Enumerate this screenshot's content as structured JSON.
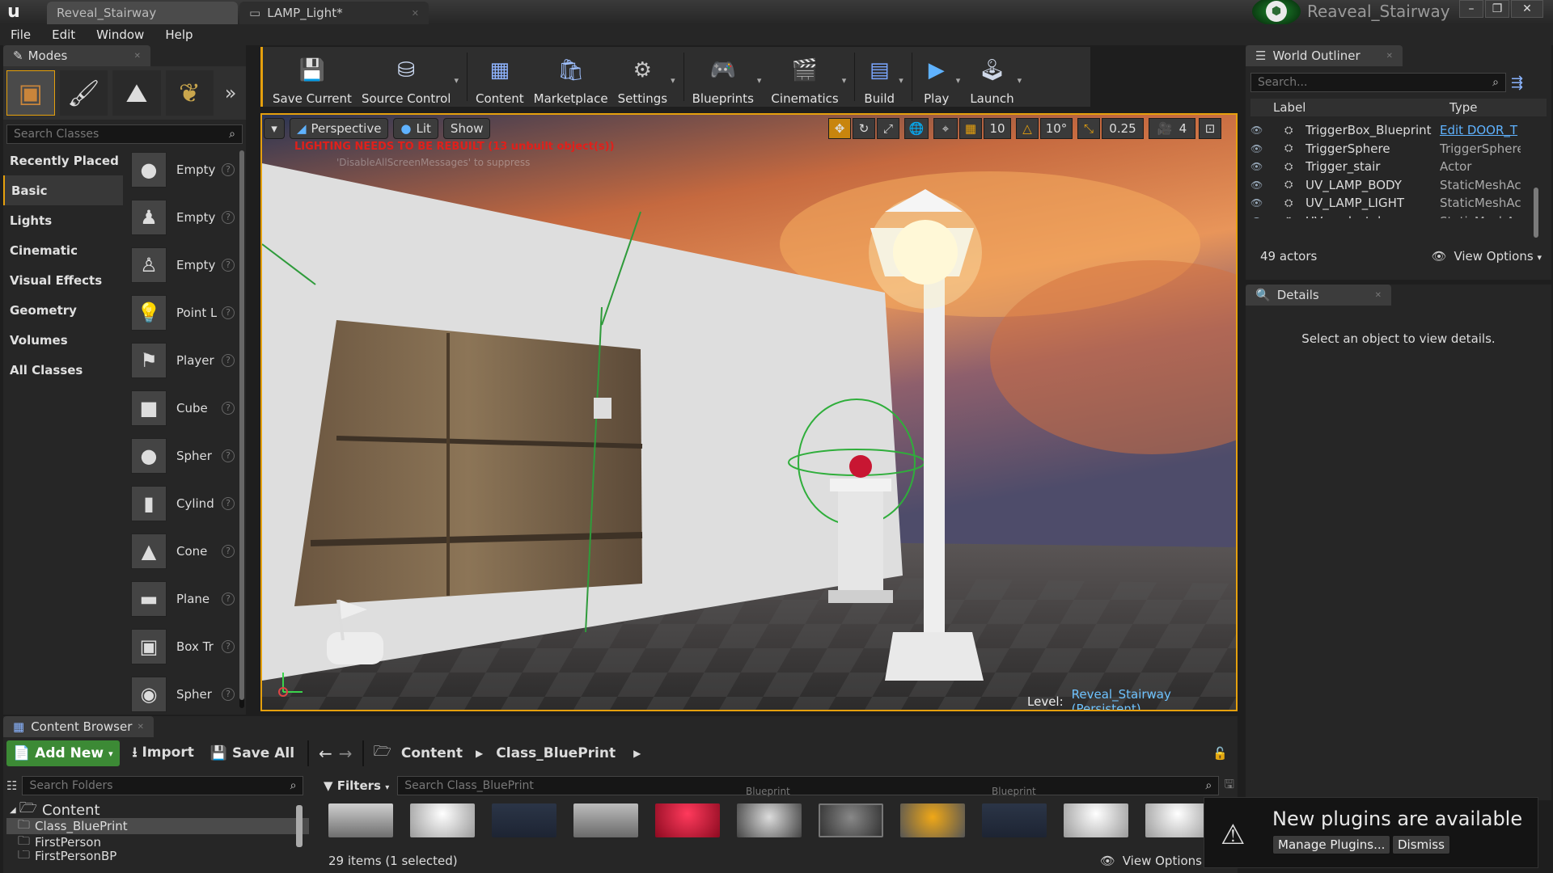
{
  "window": {
    "title": "Reaveal_Stairway",
    "doc_tabs": [
      "Reveal_Stairway",
      "LAMP_Light*"
    ]
  },
  "menu": [
    "File",
    "Edit",
    "Window",
    "Help"
  ],
  "modes": {
    "tab": "Modes",
    "search_placeholder": "Search Classes",
    "categories": [
      "Recently Placed",
      "Basic",
      "Lights",
      "Cinematic",
      "Visual Effects",
      "Geometry",
      "Volumes",
      "All Classes"
    ],
    "selected_category": "Basic",
    "items": [
      {
        "label": "Empty",
        "icon": "empty-actor-icon",
        "glyph": "●"
      },
      {
        "label": "Empty",
        "icon": "empty-character-icon",
        "glyph": "♟"
      },
      {
        "label": "Empty",
        "icon": "empty-pawn-icon",
        "glyph": "♙"
      },
      {
        "label": "Point L",
        "icon": "point-light-icon",
        "glyph": "💡"
      },
      {
        "label": "Player",
        "icon": "player-start-icon",
        "glyph": "⚑"
      },
      {
        "label": "Cube",
        "icon": "cube-icon",
        "glyph": "■"
      },
      {
        "label": "Spher",
        "icon": "sphere-icon",
        "glyph": "●"
      },
      {
        "label": "Cylind",
        "icon": "cylinder-icon",
        "glyph": "▮"
      },
      {
        "label": "Cone",
        "icon": "cone-icon",
        "glyph": "▲"
      },
      {
        "label": "Plane",
        "icon": "plane-icon",
        "glyph": "▬"
      },
      {
        "label": "Box Tr",
        "icon": "box-trigger-icon",
        "glyph": "▣"
      },
      {
        "label": "Spher",
        "icon": "sphere-trigger-icon",
        "glyph": "◉"
      }
    ]
  },
  "toolbar": [
    {
      "label": "Save Current",
      "icon": "save-icon",
      "glyph": "💾",
      "arrow": false
    },
    {
      "label": "Source Control",
      "icon": "source-control-icon",
      "glyph": "⛁",
      "arrow": true
    },
    {
      "label": "Content",
      "icon": "content-icon",
      "glyph": "▦",
      "arrow": false
    },
    {
      "label": "Marketplace",
      "icon": "marketplace-icon",
      "glyph": "🛍",
      "arrow": false
    },
    {
      "label": "Settings",
      "icon": "settings-icon",
      "glyph": "⚙",
      "arrow": true
    },
    {
      "label": "Blueprints",
      "icon": "blueprints-icon",
      "glyph": "🎮",
      "arrow": true
    },
    {
      "label": "Cinematics",
      "icon": "cinematics-icon",
      "glyph": "🎬",
      "arrow": true
    },
    {
      "label": "Build",
      "icon": "build-icon",
      "glyph": "▤",
      "arrow": true
    },
    {
      "label": "Play",
      "icon": "play-icon",
      "glyph": "▶",
      "arrow": true
    },
    {
      "label": "Launch",
      "icon": "launch-icon",
      "glyph": "🕹",
      "arrow": true
    }
  ],
  "viewport": {
    "perspective": "Perspective",
    "lit": "Lit",
    "show": "Show",
    "warning": "LIGHTING NEEDS TO BE REBUILT (13 unbuilt object(s))",
    "subwarning": "'DisableAllScreenMessages' to suppress",
    "grid": "10",
    "rotation": "10°",
    "scale": "0.25",
    "camera_speed": "4",
    "level_label": "Level:",
    "level_name": "Reveal_Stairway (Persistent)"
  },
  "outliner": {
    "tab": "World Outliner",
    "search_placeholder": "Search...",
    "col_label": "Label",
    "col_type": "Type",
    "rows": [
      {
        "label": "TriggerBox_Blueprint",
        "type": "Edit DOOR_T",
        "link": true
      },
      {
        "label": "TriggerSphere",
        "type": "TriggerSphere",
        "link": false
      },
      {
        "label": "Trigger_stair",
        "type": "Actor",
        "link": false
      },
      {
        "label": "UV_LAMP_BODY",
        "type": "StaticMeshAc",
        "link": false
      },
      {
        "label": "UV_LAMP_LIGHT",
        "type": "StaticMeshAc",
        "link": false
      },
      {
        "label": "UV_pedestal",
        "type": "StaticMeshAc",
        "link": false
      }
    ],
    "actor_count": "49 actors",
    "view_options": "View Options"
  },
  "details": {
    "tab": "Details",
    "empty_msg": "Select an object to view details."
  },
  "content_browser": {
    "tab": "Content Browser",
    "add_new": "Add New",
    "import": "Import",
    "save_all": "Save All",
    "path": [
      "Content",
      "Class_BluePrint"
    ],
    "folder_search": "Search Folders",
    "filters": "Filters",
    "asset_search": "Search Class_BluePrint",
    "tree": [
      "Content",
      "Class_BluePrint",
      "FirstPerson",
      "FirstPersonBP"
    ],
    "asset_tags": [
      "Blueprint",
      "Blueprint"
    ],
    "status": "29 items (1 selected)",
    "view_options": "View Options"
  },
  "notification": {
    "title": "New plugins are available",
    "manage": "Manage Plugins...",
    "dismiss": "Dismiss"
  },
  "colors": {
    "accent": "#e5a00d",
    "link": "#5fb2ff",
    "warning": "#e0201b",
    "addnew": "#3c8a35"
  }
}
